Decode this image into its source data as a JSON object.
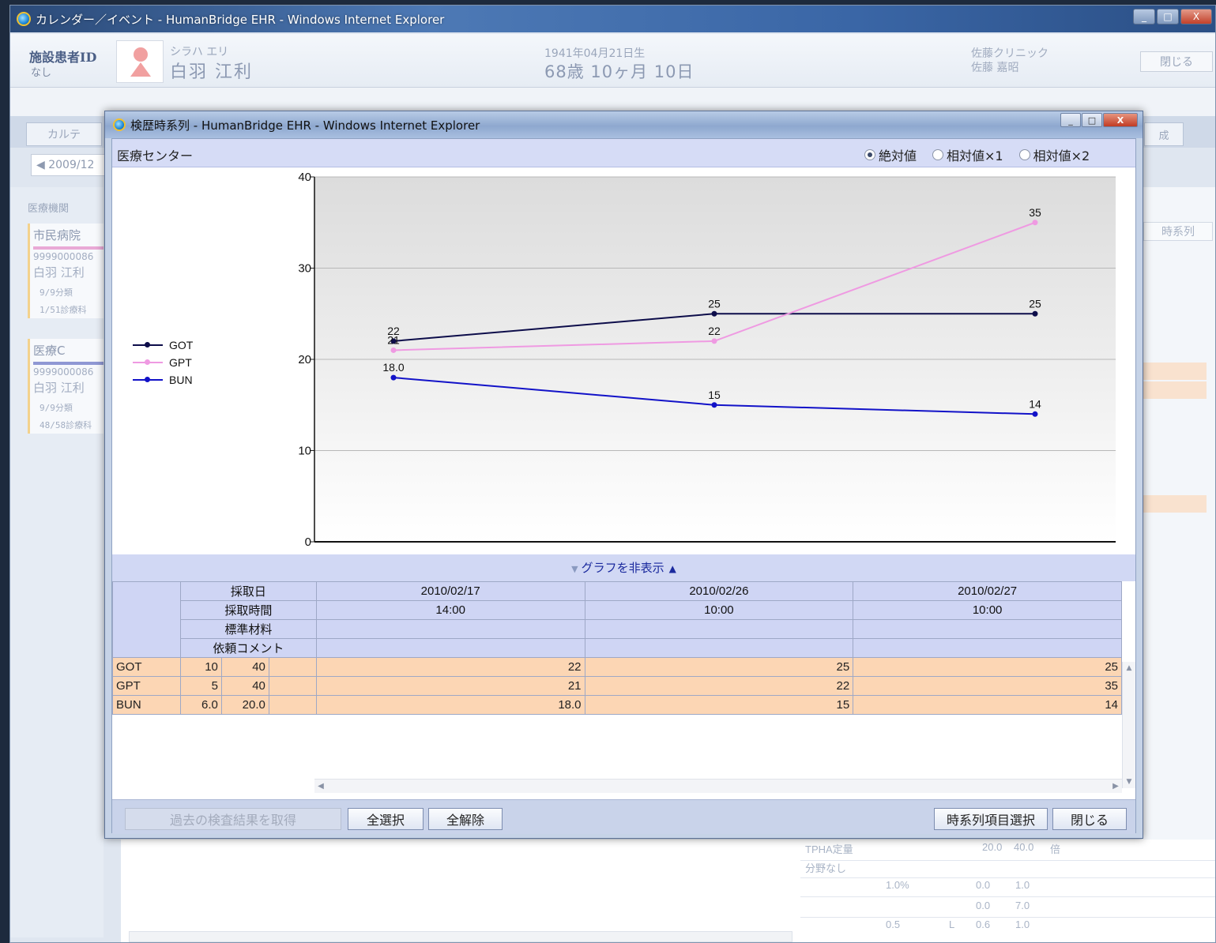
{
  "outer_window": {
    "title": "カレンダー／イベント - HumanBridge EHR - Windows Internet Explorer",
    "controls": [
      "_",
      "□",
      "X"
    ]
  },
  "patient": {
    "id_label": "施設患者ID",
    "id_value": "なし",
    "kana": "シラハ エリ",
    "name": "白羽 江利",
    "birth": "1941年04月21日生",
    "age": "68歳 10ヶ月 10日",
    "clinic_line1": "佐藤クリニック",
    "clinic_line2": "佐藤 嘉昭",
    "close_label": "閉じる"
  },
  "background": {
    "tab_karte": "カルテ",
    "tab_right": "成",
    "date": "◀ 2009/12",
    "inst_label": "医療機関",
    "timeseries_label": "時系列",
    "cards": [
      {
        "title": "市民病院",
        "bar": "#e9a9d6",
        "id": "9999000086",
        "name": "白羽 江利",
        "c1": "9/9分類",
        "c2": "1/51診療科"
      },
      {
        "title": "医療C",
        "bar": "#8f98d4",
        "id": "9999000086",
        "name": "白羽 江利",
        "c1": "9/9分類",
        "c2": "48/58診療科"
      }
    ],
    "grid": {
      "r1": [
        "TPHA定量",
        "",
        "20.0",
        "40.0",
        "倍"
      ],
      "r2": [
        "分野なし"
      ],
      "r3": [
        "1.0%",
        "",
        "0.0",
        "1.0"
      ],
      "r4": [
        "",
        "",
        "0.0",
        "7.0"
      ],
      "r5": [
        "0.5",
        "L",
        "0.6",
        "1.0"
      ]
    }
  },
  "dialog": {
    "title": "検歴時系列 - HumanBridge EHR - Windows Internet Explorer",
    "controls": [
      "_",
      "□",
      "X"
    ],
    "institution": "医療センター",
    "radios": [
      {
        "label": "絶対値",
        "checked": true
      },
      {
        "label": "相対値×1",
        "checked": false
      },
      {
        "label": "相対値×2",
        "checked": false
      }
    ],
    "graph_toggle_label": "グラフを非表示",
    "graph_toggle_left": "▼",
    "graph_toggle_right": "▲",
    "table": {
      "header_rows": [
        "採取日",
        "採取時間",
        "標準材料",
        "依頼コメント"
      ],
      "dates": [
        "2010/02/17",
        "2010/02/26",
        "2010/02/27"
      ],
      "times": [
        "14:00",
        "10:00",
        "10:00"
      ],
      "materials": [
        "",
        "",
        ""
      ],
      "comments": [
        "",
        "",
        ""
      ],
      "rows": [
        {
          "name": "GOT",
          "low": "10",
          "high": "40",
          "values": [
            "22",
            "25",
            "25"
          ]
        },
        {
          "name": "GPT",
          "low": "5",
          "high": "40",
          "values": [
            "21",
            "22",
            "35"
          ]
        },
        {
          "name": "BUN",
          "low": "6.0",
          "high": "20.0",
          "values": [
            "18.0",
            "15",
            "14"
          ]
        }
      ]
    },
    "buttons": {
      "fetch_past": "過去の検査結果を取得",
      "select_all": "全選択",
      "clear_all": "全解除",
      "select_items": "時系列項目選択",
      "close": "閉じる"
    }
  },
  "chart_data": {
    "type": "line",
    "categories": [
      "2010/02/17",
      "2010/02/26",
      "2010/02/27"
    ],
    "ylim": [
      0,
      40
    ],
    "yticks": [
      0,
      10,
      20,
      30,
      40
    ],
    "grid": true,
    "legend_position": "left",
    "series": [
      {
        "name": "GOT",
        "color": "#0d0d4a",
        "values": [
          22,
          25,
          25
        ],
        "labels": [
          "22",
          "25",
          "25"
        ]
      },
      {
        "name": "GPT",
        "color": "#ef9ae2",
        "values": [
          21,
          22,
          35
        ],
        "labels": [
          "21",
          "22",
          "35"
        ]
      },
      {
        "name": "BUN",
        "color": "#1212c8",
        "values": [
          18,
          15,
          14
        ],
        "labels": [
          "18.0",
          "15",
          "14"
        ]
      }
    ]
  }
}
